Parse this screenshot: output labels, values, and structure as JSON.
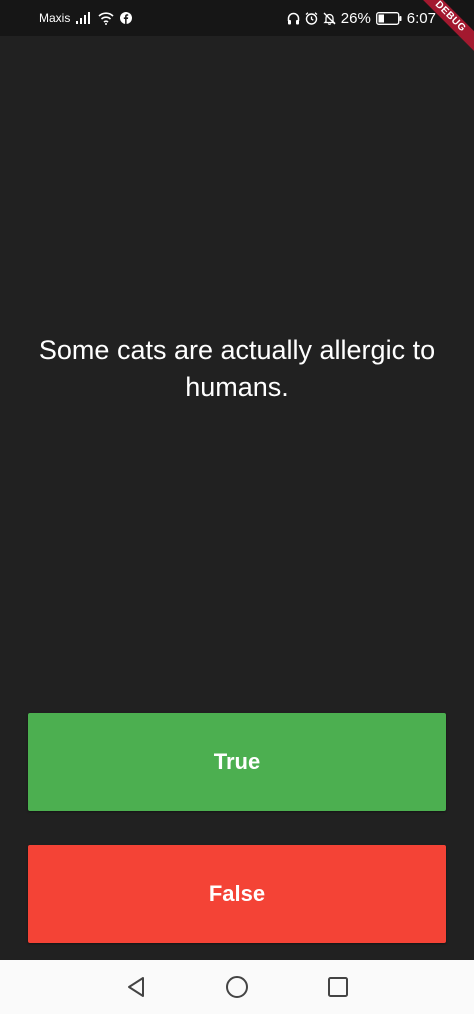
{
  "status_bar": {
    "carrier": "Maxis",
    "battery_percent": "26%",
    "time": "6:07",
    "icons": [
      "signal-icon",
      "wifi-icon",
      "facebook-icon",
      "headphones-icon",
      "alarm-icon",
      "mute-icon",
      "battery-icon"
    ]
  },
  "debug_banner": "DEBUG",
  "question": "Some cats are actually allergic to humans.",
  "buttons": {
    "true_label": "True",
    "false_label": "False"
  },
  "colors": {
    "background": "#212121",
    "true": "#4caf50",
    "false": "#f44336"
  },
  "nav_bar": {
    "icons": [
      "back-icon",
      "home-icon",
      "recents-icon"
    ]
  }
}
